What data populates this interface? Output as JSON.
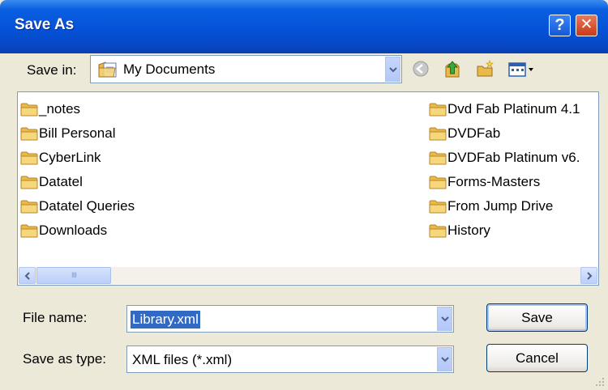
{
  "window": {
    "title": "Save As"
  },
  "titlebar": {
    "help_glyph": "?",
    "close_glyph": "✕"
  },
  "save_in": {
    "label": "Save in:",
    "value": "My Documents"
  },
  "toolbar": {
    "icons": [
      "back-icon",
      "up-one-level-icon",
      "create-new-folder-icon",
      "view-menu-icon"
    ]
  },
  "files": {
    "left": [
      "_notes",
      "Bill Personal",
      "CyberLink",
      "Datatel",
      "Datatel Queries",
      "Downloads"
    ],
    "right": [
      "Dvd Fab Platinum 4.1",
      "DVDFab",
      "DVDFab Platinum v6.",
      "Forms-Masters",
      "From Jump Drive",
      "History"
    ]
  },
  "scrollbar": {
    "thumb_grip": "IIII"
  },
  "file_name": {
    "label": "File name:",
    "value": "Library.xml"
  },
  "save_type": {
    "label": "Save as type:",
    "value": "XML files (*.xml)"
  },
  "buttons": {
    "save": "Save",
    "cancel": "Cancel"
  },
  "colors": {
    "title_bar": "#0552d8",
    "selection": "#316ac5",
    "dialog_bg": "#ece9d8",
    "close_button": "#c8391a"
  }
}
